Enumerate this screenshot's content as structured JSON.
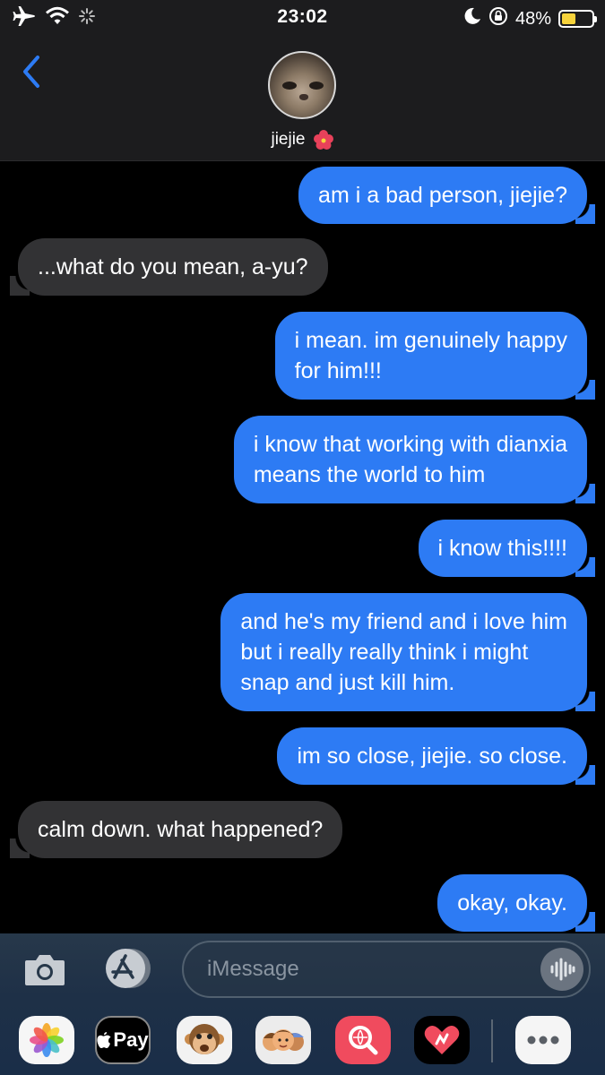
{
  "status_bar": {
    "time": "23:02",
    "battery_percent": "48%",
    "battery_level": 0.48,
    "icons": [
      "airplane-icon",
      "wifi-icon",
      "loading-spinner-icon",
      "moon-icon",
      "orientation-lock-icon",
      "battery-icon"
    ]
  },
  "header": {
    "contact_name": "jiejie",
    "contact_emoji": "flower-icon",
    "back_icon": "chevron-left-icon"
  },
  "messages": [
    {
      "from": "me",
      "text": "am i a bad person, jiejie?"
    },
    {
      "from": "them",
      "text": "...what do you mean, a-yu?"
    },
    {
      "from": "me",
      "lines": [
        "i mean. im genuinely happy",
        "for him!!!"
      ]
    },
    {
      "from": "me",
      "lines": [
        "i know that working with dianxia",
        "means the world to him"
      ]
    },
    {
      "from": "me",
      "text": "i know this!!!!"
    },
    {
      "from": "me",
      "lines": [
        "and he's my friend and i love him",
        "but i really really think i might",
        "snap and just kill him."
      ]
    },
    {
      "from": "me",
      "text": "im so close, jiejie. so close."
    },
    {
      "from": "them",
      "text": "calm down. what happened?"
    },
    {
      "from": "me",
      "text": "okay, okay."
    }
  ],
  "input": {
    "placeholder": "iMessage"
  },
  "app_drawer": {
    "apple_pay_label": "Pay",
    "apps": [
      "photos-app-icon",
      "apple-pay-app-icon",
      "animoji-app-icon",
      "memoji-app-icon",
      "search-images-app-icon",
      "digital-touch-app-icon",
      "more-apps-icon"
    ]
  },
  "colors": {
    "sent_bubble": "#2d7bf4",
    "received_bubble": "#323234",
    "accent": "#2d7bf4",
    "battery_fill": "#f7d33c"
  }
}
